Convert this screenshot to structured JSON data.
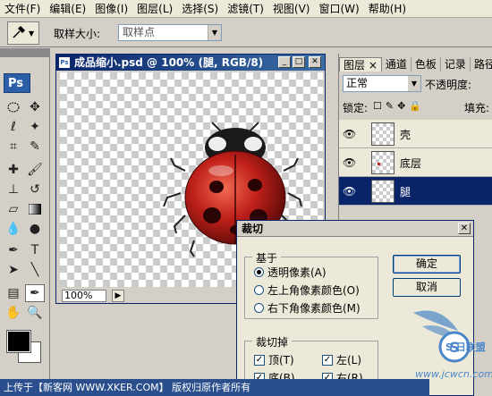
{
  "menu": [
    "文件(F)",
    "编辑(E)",
    "图像(I)",
    "图层(L)",
    "选择(S)",
    "滤镜(T)",
    "视图(V)",
    "窗口(W)",
    "帮助(H)"
  ],
  "options_bar": {
    "sample_size_label": "取样大小:",
    "sample_value": "取样点"
  },
  "toolbox": {
    "logo": "Ps"
  },
  "document": {
    "title": "成品缩小.psd @ 100% (腿, RGB/8)",
    "zoom": "100%"
  },
  "layers_panel": {
    "tabs": [
      "图层 ×",
      "通道",
      "色板",
      "记录",
      "路径"
    ],
    "blend_mode": "正常",
    "opacity_label": "不透明度:",
    "lock_label": "锁定:",
    "fill_label": "填充:",
    "layers": [
      {
        "name": "壳",
        "visible": true,
        "selected": false
      },
      {
        "name": "底层",
        "visible": true,
        "selected": false
      },
      {
        "name": "腿",
        "visible": true,
        "selected": true
      }
    ]
  },
  "crop_dialog": {
    "title": "裁切",
    "based_on_legend": "基于",
    "options": [
      "透明像素(A)",
      "左上角像素颜色(O)",
      "右下角像素颜色(M)"
    ],
    "selected_option": 0,
    "trim_away_legend": "裁切掉",
    "checks": {
      "top": "顶(T)",
      "bottom": "底(B)",
      "left": "左(L)",
      "right": "右(R)"
    },
    "ok": "确定",
    "cancel": "取消"
  },
  "watermark": {
    "site": "www.jcwcn.com",
    "brand": "S 日联盟"
  },
  "bottom_strip": "上传于【新客网 WWW.XKER.COM】 版权归原作者所有",
  "colors": {
    "accent": "#0a246a",
    "ladybug_red": "#c0201a",
    "watermark_blue": "#4a86c8"
  }
}
